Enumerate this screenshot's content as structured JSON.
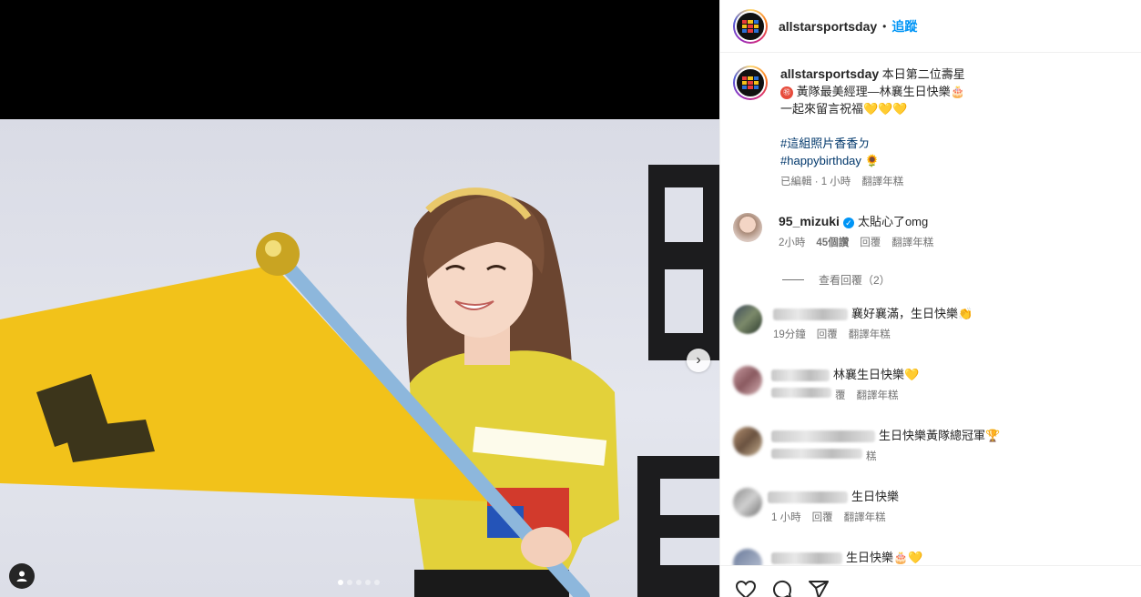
{
  "post": {
    "username": "allstarsportsday",
    "follow_label": "追蹤",
    "separator": "•"
  },
  "caption": {
    "username": "allstarsportsday",
    "line1": "本日第二位壽星",
    "line2": "黃隊最美經理—林襄生日快樂🎂",
    "line3": "一起來留言祝福💛💛💛",
    "hashtag1": "#這組照片香香ㄉ",
    "hashtag2": "#happybirthday",
    "hashtag2_emoji": "🌻",
    "meta_edited": "已編輯 · 1 小時",
    "meta_translate": "翻譯年糕"
  },
  "comments": [
    {
      "username": "95_mizuki",
      "verified": true,
      "text": "太貼心了omg",
      "time": "2小時",
      "likes": "45個讚",
      "reply": "回覆",
      "translate": "翻譯年糕",
      "view_replies": "查看回覆（2）"
    },
    {
      "username": "",
      "text": "襄好襄滿，生日快樂👏",
      "time": "19分鐘",
      "reply": "回覆",
      "translate": "翻譯年糕"
    },
    {
      "username": "",
      "text": "林襄生日快樂💛",
      "time": "",
      "reply": "覆",
      "translate": "翻譯年糕"
    },
    {
      "username": "",
      "text": "生日快樂黃隊總冠軍🏆",
      "time": "",
      "reply": "",
      "translate": "糕"
    },
    {
      "username": "",
      "text": "生日快樂",
      "time": "1 小時",
      "reply": "回覆",
      "translate": "翻譯年糕"
    },
    {
      "username": "",
      "text": "生日快樂🎂💛",
      "time": "",
      "reply": "",
      "translate": ""
    }
  ],
  "carousel": {
    "total": 5,
    "active": 1,
    "next_icon": "chevron-right-icon"
  },
  "actions": [
    "heart-icon",
    "comment-icon",
    "share-icon"
  ],
  "colors": {
    "follow": "#0095f6",
    "hashtag": "#00376b",
    "flag": "#f2c21a",
    "shirt": "#e3d13a"
  }
}
